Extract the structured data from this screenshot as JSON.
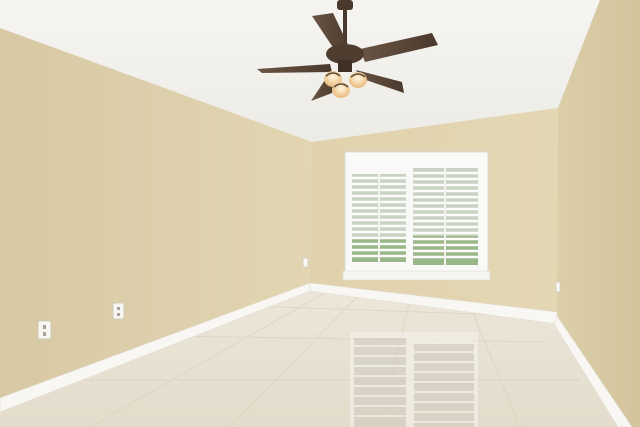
{
  "scene": {
    "description_colors": {
      "ceiling": "#f4f2ec",
      "wall_left": "#ddd0ad",
      "wall_back": "#e0d2ad",
      "wall_right": "#d8caa4",
      "floor": "#e8e2d4",
      "baseboard": "#f7f6f2",
      "window_frame": "#f8f8f6",
      "fan_blade": "#5a4636",
      "fan_light": "#f3d9a4"
    },
    "objects": [
      {
        "name": "ceiling-fan"
      },
      {
        "name": "plantation-shutter-window"
      },
      {
        "name": "electrical-outlet"
      },
      {
        "name": "tile-floor"
      }
    ]
  }
}
